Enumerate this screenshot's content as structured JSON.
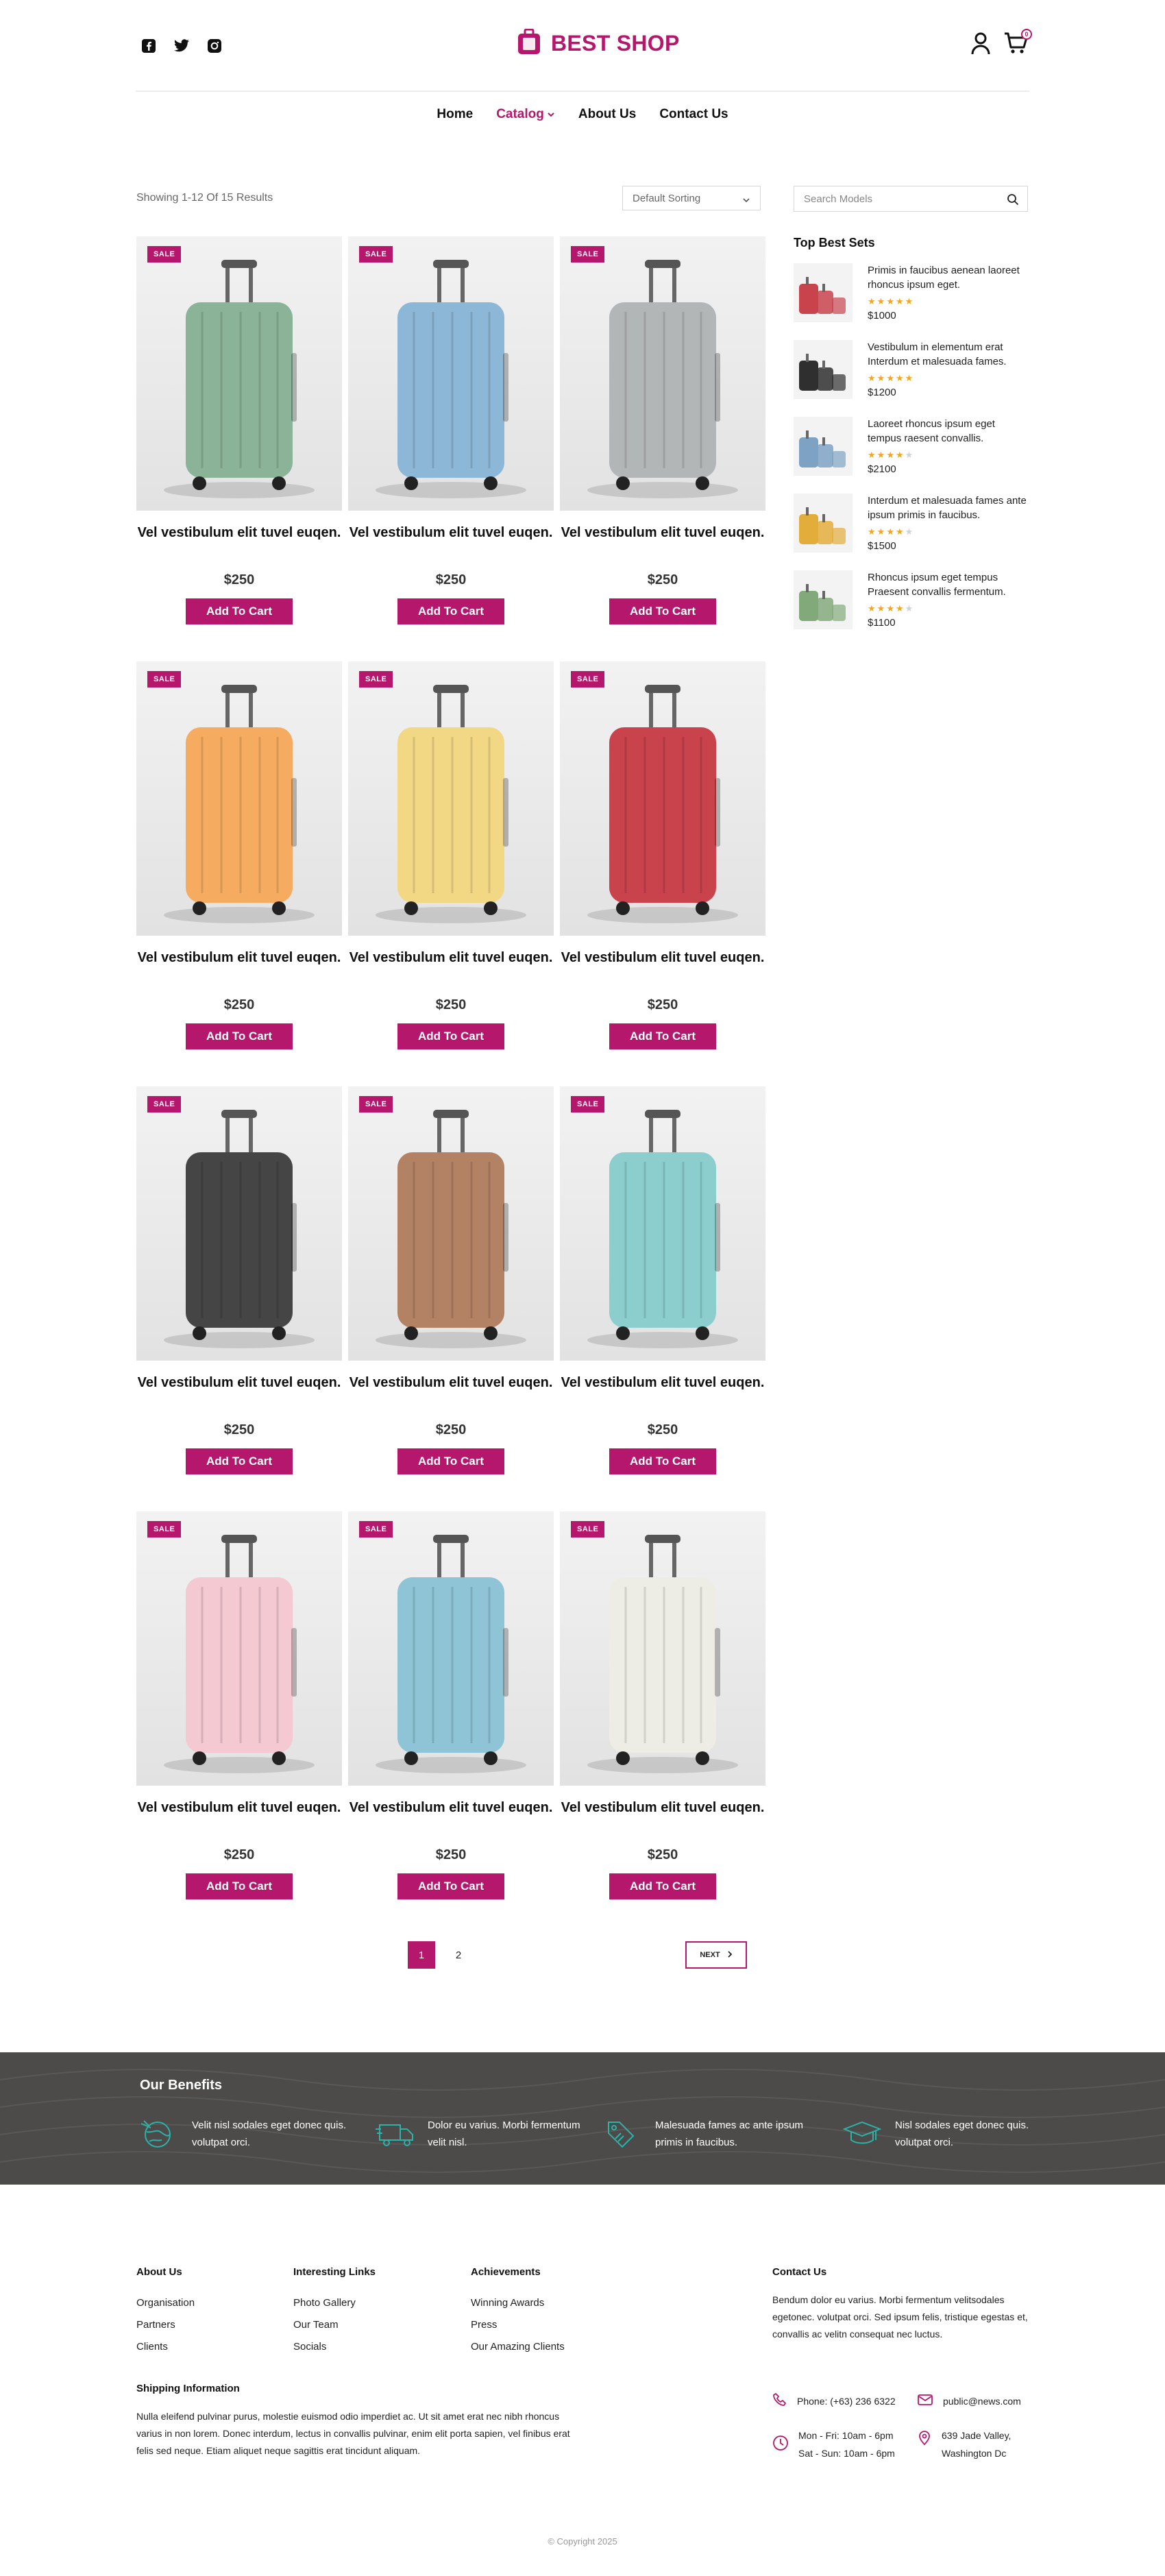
{
  "brand": {
    "name": "BEST SHOP",
    "accent": "#b5176c"
  },
  "header": {
    "socials": [
      "facebook-icon",
      "twitter-icon",
      "instagram-icon"
    ],
    "cart_count": "0"
  },
  "nav": [
    {
      "label": "Home"
    },
    {
      "label": "Catalog"
    },
    {
      "label": "About Us"
    },
    {
      "label": "Contact Us"
    }
  ],
  "toolbar": {
    "results": "Showing 1-12 Of 15 Results",
    "sort": "Default Sorting"
  },
  "products": [
    {
      "badge": "SALE",
      "title": "Vel vestibulum elit tuvel euqen.",
      "price": "$250",
      "button": "Add To Cart",
      "color": "#7aa98a"
    },
    {
      "badge": "SALE",
      "title": "Vel vestibulum elit tuvel euqen.",
      "price": "$250",
      "button": "Add To Cart",
      "color": "#7eaed1"
    },
    {
      "badge": "SALE",
      "title": "Vel vestibulum elit tuvel euqen.",
      "price": "$250",
      "button": "Add To Cart",
      "color": "#a9acae"
    },
    {
      "badge": "SALE",
      "title": "Vel vestibulum elit tuvel euqen.",
      "price": "$250",
      "button": "Add To Cart",
      "color": "#f5a14a"
    },
    {
      "badge": "SALE",
      "title": "Vel vestibulum elit tuvel euqen.",
      "price": "$250",
      "button": "Add To Cart",
      "color": "#f1d374"
    },
    {
      "badge": "SALE",
      "title": "Vel vestibulum elit tuvel euqen.",
      "price": "$250",
      "button": "Add To Cart",
      "color": "#c22a35"
    },
    {
      "badge": "SALE",
      "title": "Vel vestibulum elit tuvel euqen.",
      "price": "$250",
      "button": "Add To Cart",
      "color": "#2c2c2c"
    },
    {
      "badge": "SALE",
      "title": "Vel vestibulum elit tuvel euqen.",
      "price": "$250",
      "button": "Add To Cart",
      "color": "#a9704f"
    },
    {
      "badge": "SALE",
      "title": "Vel vestibulum elit tuvel euqen.",
      "price": "$250",
      "button": "Add To Cart",
      "color": "#7cc8c6"
    },
    {
      "badge": "SALE",
      "title": "Vel vestibulum elit tuvel euqen.",
      "price": "$250",
      "button": "Add To Cart",
      "color": "#f3c2cc"
    },
    {
      "badge": "SALE",
      "title": "Vel vestibulum elit tuvel euqen.",
      "price": "$250",
      "button": "Add To Cart",
      "color": "#7fbcd1"
    },
    {
      "badge": "SALE",
      "title": "Vel vestibulum elit tuvel euqen.",
      "price": "$250",
      "button": "Add To Cart",
      "color": "#ecebe2"
    }
  ],
  "pagination": {
    "pages": [
      "1",
      "2"
    ],
    "next": "NEXT"
  },
  "sidebar": {
    "search_placeholder": "Search Models",
    "title": "Top Best Sets",
    "items": [
      {
        "text": "Primis in faucibus aenean laoreet rhoncus ipsum eget.",
        "rating": 5,
        "price": "$1000",
        "color": "#c9434d"
      },
      {
        "text": "Vestibulum in elementum erat Interdum et malesuada fames.",
        "rating": 5,
        "price": "$1200",
        "color": "#2f2f2f"
      },
      {
        "text": "Laoreet rhoncus ipsum eget tempus raesent convallis.",
        "rating": 4,
        "price": "$2100",
        "color": "#7ea2c4"
      },
      {
        "text": "Interdum et malesuada fames ante ipsum primis in faucibus.",
        "rating": 4,
        "price": "$1500",
        "color": "#e3ad3b"
      },
      {
        "text": "Rhoncus ipsum eget tempus Praesent convallis fermentum.",
        "rating": 4,
        "price": "$1100",
        "color": "#82a97a"
      }
    ]
  },
  "benefits": {
    "title": "Our Benefits",
    "items": [
      {
        "icon": "globe-icon",
        "text": "Velit nisl sodales eget donec quis. volutpat orci."
      },
      {
        "icon": "delivery-truck-icon",
        "text": "Dolor eu varius. Morbi fermentum velit nisl."
      },
      {
        "icon": "tag-icon",
        "text": "Malesuada fames ac ante ipsum primis in faucibus."
      },
      {
        "icon": "graduation-cap-icon",
        "text": "Nisl sodales eget donec quis. volutpat orci."
      }
    ]
  },
  "footer": {
    "about": {
      "title": "About Us",
      "links": [
        "Organisation",
        "Partners",
        "Clients"
      ]
    },
    "interesting": {
      "title": "Interesting Links",
      "links": [
        "Photo Gallery",
        "Our Team",
        "Socials"
      ]
    },
    "achievements": {
      "title": "Achievements",
      "links": [
        "Winning Awards",
        "Press",
        "Our Amazing Clients"
      ]
    },
    "shipping": {
      "title": "Shipping Information",
      "text": "Nulla eleifend pulvinar purus, molestie euismod odio imperdiet ac. Ut sit amet erat nec nibh rhoncus varius in non lorem. Donec interdum, lectus in convallis pulvinar, enim elit porta sapien, vel finibus erat felis sed neque. Etiam aliquet neque sagittis erat tincidunt aliquam."
    },
    "contact": {
      "title": "Contact Us",
      "text": "Bendum dolor eu varius. Morbi fermentum velitsodales egetonec. volutpat orci. Sed ipsum felis, tristique egestas et, convallis ac velitn consequat nec luctus.",
      "phone": "Phone: (+63) 236 6322",
      "email": "public@news.com",
      "hours1": "Mon - Fri: 10am - 6pm",
      "hours2": "Sat - Sun: 10am - 6pm",
      "address1": "639 Jade Valley,",
      "address2": "Washington Dc"
    },
    "copyright": "© Copyright 2025"
  }
}
